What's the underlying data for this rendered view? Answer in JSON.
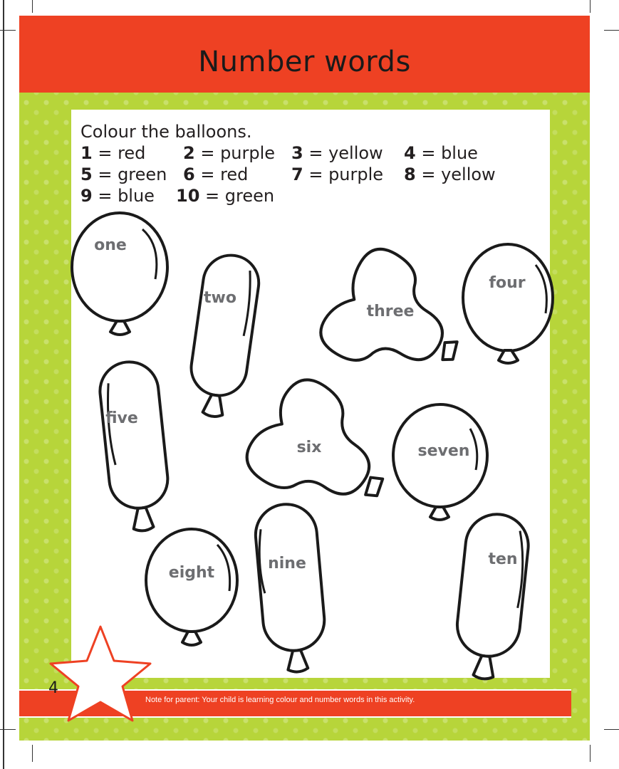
{
  "header": {
    "title": "Number words"
  },
  "instructions": {
    "heading": "Colour the balloons.",
    "key": [
      [
        {
          "num": "1",
          "text": " = red"
        },
        {
          "num": "2",
          "text": " = purple"
        },
        {
          "num": "3",
          "text": " = yellow"
        },
        {
          "num": "4",
          "text": " = blue"
        }
      ],
      [
        {
          "num": "5",
          "text": " = green"
        },
        {
          "num": "6",
          "text": " = red"
        },
        {
          "num": "7",
          "text": " = purple"
        },
        {
          "num": "8",
          "text": " = yellow"
        }
      ],
      [
        {
          "num": "9",
          "text": " = blue"
        },
        {
          "num": "10",
          "text": " = green"
        }
      ]
    ]
  },
  "balloons": [
    "one",
    "two",
    "three",
    "four",
    "five",
    "six",
    "seven",
    "eight",
    "nine",
    "ten"
  ],
  "footer": {
    "page_number": "4",
    "note": "Note for parent: Your child is learning colour and number words in this activity."
  },
  "colors": {
    "header_band": "#ee4123",
    "background_green": "#b7d53a",
    "balloon_label": "#6d6e71",
    "star_outline": "#ee4123"
  }
}
